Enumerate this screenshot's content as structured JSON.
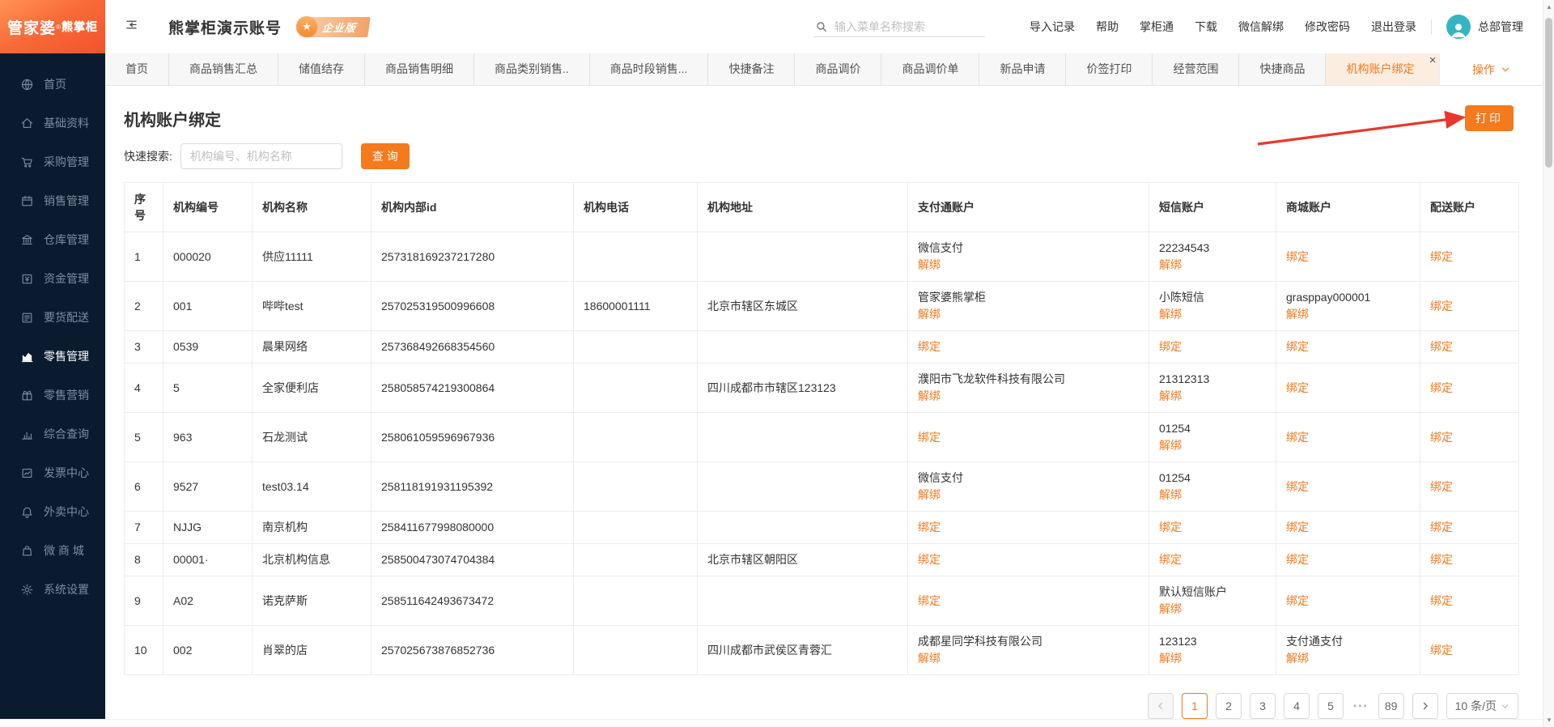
{
  "header": {
    "logo_brand": "管家婆",
    "logo_sub": "熊掌柜",
    "account_title": "熊掌柜演示账号",
    "badge": "企业版",
    "search_placeholder": "输入菜单名称搜索",
    "menu": [
      "导入记录",
      "帮助",
      "掌柜通",
      "下载",
      "微信解绑",
      "修改密码",
      "退出登录"
    ],
    "user": "总部管理"
  },
  "sidebar": {
    "active_index": 7,
    "items": [
      {
        "key": "home",
        "icon": "globe",
        "label": "首页"
      },
      {
        "key": "basic",
        "icon": "house",
        "label": "基础资料"
      },
      {
        "key": "purchase",
        "icon": "cart",
        "label": "采购管理"
      },
      {
        "key": "sales",
        "icon": "calendar",
        "label": "销售管理"
      },
      {
        "key": "warehouse",
        "icon": "bank",
        "label": "仓库管理"
      },
      {
        "key": "funds",
        "icon": "money",
        "label": "资金管理"
      },
      {
        "key": "dispatch",
        "icon": "list",
        "label": "要货配送"
      },
      {
        "key": "retail",
        "icon": "area-chart",
        "label": "零售管理"
      },
      {
        "key": "marketing",
        "icon": "gift",
        "label": "零售营销"
      },
      {
        "key": "query",
        "icon": "bar-chart",
        "label": "综合查询"
      },
      {
        "key": "invoice",
        "icon": "line-chart",
        "label": "发票中心"
      },
      {
        "key": "takeout",
        "icon": "bell",
        "label": "外卖中心"
      },
      {
        "key": "mall",
        "icon": "bag",
        "label": "微 商 城"
      },
      {
        "key": "settings",
        "icon": "gear",
        "label": "系统设置"
      }
    ]
  },
  "tabs": {
    "action_label": "操作",
    "items": [
      {
        "label": "首页"
      },
      {
        "label": "商品销售汇总"
      },
      {
        "label": "储值结存"
      },
      {
        "label": "商品销售明细"
      },
      {
        "label": "商品类别销售.."
      },
      {
        "label": "商品时段销售..."
      },
      {
        "label": "快捷备注"
      },
      {
        "label": "商品调价"
      },
      {
        "label": "商品调价单"
      },
      {
        "label": "新品申请"
      },
      {
        "label": "价签打印"
      },
      {
        "label": "经营范围"
      },
      {
        "label": "快捷商品"
      },
      {
        "label": "机构账户绑定",
        "active": true,
        "closable": true
      }
    ]
  },
  "page": {
    "title": "机构账户绑定",
    "print_button": "打印",
    "search_label": "快速搜索:",
    "search_placeholder": "机构编号、机构名称",
    "query_button": "查 询"
  },
  "table": {
    "columns": [
      "序号",
      "机构编号",
      "机构名称",
      "机构内部id",
      "机构电话",
      "机构地址",
      "支付通账户",
      "短信账户",
      "商城账户",
      "配送账户"
    ],
    "rows": [
      {
        "seq": "1",
        "code": "000020",
        "name": "供应11111",
        "internal_id": "257318169237217280",
        "phone": "",
        "address": "",
        "pay": {
          "text": "微信支付",
          "action": "解绑"
        },
        "sms": {
          "text": "22234543",
          "action": "解绑"
        },
        "mall": {
          "action": "绑定"
        },
        "delivery": {
          "action": "绑定"
        }
      },
      {
        "seq": "2",
        "code": "001",
        "name": "哔哔test",
        "internal_id": "257025319500996608",
        "phone": "18600001111",
        "address": "北京市辖区东城区",
        "pay": {
          "text": "管家婆熊掌柜",
          "action": "解绑"
        },
        "sms": {
          "text": "小陈短信",
          "action": "解绑"
        },
        "mall": {
          "text": "grasppay000001",
          "action": "解绑"
        },
        "delivery": {
          "action": "绑定"
        }
      },
      {
        "seq": "3",
        "code": "0539",
        "name": "晨果网络",
        "internal_id": "257368492668354560",
        "phone": "",
        "address": "",
        "pay": {
          "action": "绑定"
        },
        "sms": {
          "action": "绑定"
        },
        "mall": {
          "action": "绑定"
        },
        "delivery": {
          "action": "绑定"
        }
      },
      {
        "seq": "4",
        "code": "5",
        "name": "全家便利店",
        "internal_id": "258058574219300864",
        "phone": "",
        "address": "四川成都市市辖区123123",
        "pay": {
          "text": "濮阳市飞龙软件科技有限公司",
          "action": "解绑"
        },
        "sms": {
          "text": "21312313",
          "action": "解绑"
        },
        "mall": {
          "action": "绑定"
        },
        "delivery": {
          "action": "绑定"
        }
      },
      {
        "seq": "5",
        "code": "963",
        "name": "石龙测试",
        "internal_id": "258061059596967936",
        "phone": "",
        "address": "",
        "pay": {
          "action": "绑定"
        },
        "sms": {
          "text": "01254",
          "action": "解绑"
        },
        "mall": {
          "action": "绑定"
        },
        "delivery": {
          "action": "绑定"
        }
      },
      {
        "seq": "6",
        "code": "9527",
        "name": "test03.14",
        "internal_id": "258118191931195392",
        "phone": "",
        "address": "",
        "pay": {
          "text": "微信支付",
          "action": "解绑"
        },
        "sms": {
          "text": "01254",
          "action": "解绑"
        },
        "mall": {
          "action": "绑定"
        },
        "delivery": {
          "action": "绑定"
        }
      },
      {
        "seq": "7",
        "code": "NJJG",
        "name": "南京机构",
        "internal_id": "258411677998080000",
        "phone": "",
        "address": "",
        "pay": {
          "action": "绑定"
        },
        "sms": {
          "action": "绑定"
        },
        "mall": {
          "action": "绑定"
        },
        "delivery": {
          "action": "绑定"
        }
      },
      {
        "seq": "8",
        "code": "00001·",
        "name": "北京机构信息",
        "internal_id": "258500473074704384",
        "phone": "",
        "address": "北京市辖区朝阳区",
        "pay": {
          "action": "绑定"
        },
        "sms": {
          "action": "绑定"
        },
        "mall": {
          "action": "绑定"
        },
        "delivery": {
          "action": "绑定"
        }
      },
      {
        "seq": "9",
        "code": "A02",
        "name": "诺克萨斯",
        "internal_id": "258511642493673472",
        "phone": "",
        "address": "",
        "pay": {
          "action": "绑定"
        },
        "sms": {
          "text": "默认短信账户",
          "action": "解绑"
        },
        "mall": {
          "action": "绑定"
        },
        "delivery": {
          "action": "绑定"
        }
      },
      {
        "seq": "10",
        "code": "002",
        "name": "肖翠的店",
        "internal_id": "257025673876852736",
        "phone": "",
        "address": "四川成都市武侯区青蓉汇",
        "pay": {
          "text": "成都星同学科技有限公司",
          "action": "解绑"
        },
        "sms": {
          "text": "123123",
          "action": "解绑"
        },
        "mall": {
          "text": "支付通支付",
          "action": "解绑"
        },
        "delivery": {
          "action": "绑定"
        }
      }
    ]
  },
  "pagination": {
    "active_page": "1",
    "pages": [
      "1",
      "2",
      "3",
      "4",
      "5"
    ],
    "ellipsis": "•••",
    "last_page": "89",
    "page_size": "10 条/页"
  },
  "colors": {
    "primary_orange": "#F5791D",
    "sidebar_bg": "#0A1B30",
    "active_tab_bg": "#FCEDE1",
    "logo_gradient_start": "#FF9355",
    "logo_gradient_end": "#F1532B",
    "annotation_arrow_red": "#E8382C",
    "avatar_teal": "#35B5C4"
  }
}
